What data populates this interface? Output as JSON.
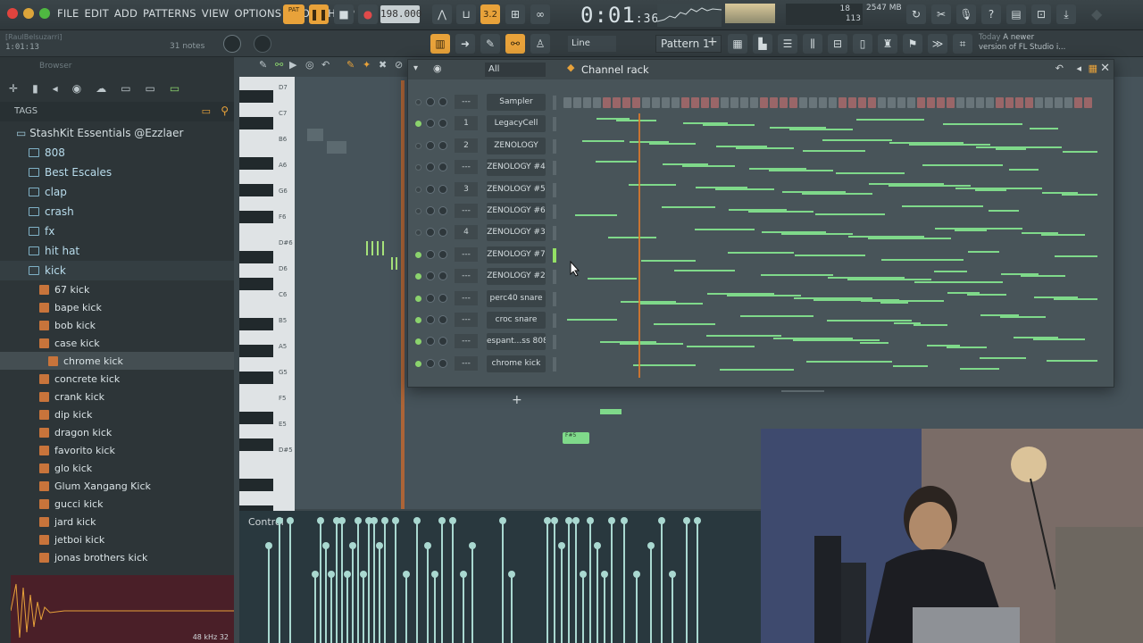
{
  "menu": [
    "FILE",
    "EDIT",
    "ADD",
    "PATTERNS",
    "VIEW",
    "OPTIONS",
    "TOOLS",
    "HELP"
  ],
  "transport": {
    "pat_label": "PAT",
    "tempo": "198.000",
    "time_main": "0:01",
    "time_sub": ":36",
    "cpu": "18",
    "mem": "2547 MB",
    "mem2": "113"
  },
  "toolbar2": {
    "user": "[RaulBelsuzarri]",
    "position": "1:01:13",
    "notes": "31 notes",
    "line_mode": "Line",
    "pattern": "Pattern 1",
    "news_date": "Today",
    "news_text1": "A newer",
    "news_text2": "version of FL Studio i..."
  },
  "browser": {
    "title": "Browser",
    "tags_label": "TAGS",
    "root": "StashKit Essentials @Ezzlaer",
    "folders": [
      "808",
      "Best Escales",
      "clap",
      "crash",
      "fx",
      "hit hat",
      "kick"
    ],
    "files": [
      "67 kick",
      "bape kick",
      "bob kick",
      "case kick",
      "chrome kick",
      "concrete kick",
      "crank kick",
      "dip kick",
      "dragon kick",
      "favorito kick",
      "glo kick",
      "Glum Xangang Kick",
      "gucci kick",
      "jard kick",
      "jetboi kick",
      "jonas brothers kick"
    ],
    "selected_file": "chrome kick",
    "wave_info": "48 kHz 32"
  },
  "pianoroll": {
    "control_label": "Control",
    "key_labels": [
      "D7",
      "C7",
      "B6",
      "A6",
      "G6",
      "F6",
      "D#6",
      "D6",
      "C6",
      "B5",
      "A5",
      "G5",
      "F5",
      "E5",
      "D#5"
    ],
    "note_label": "F#5"
  },
  "rack": {
    "title": "Channel rack",
    "filter": "All",
    "channels": [
      {
        "route": "---",
        "name": "Sampler",
        "led": false
      },
      {
        "route": "1",
        "name": "LegacyCell",
        "led": true
      },
      {
        "route": "2",
        "name": "ZENOLOGY",
        "led": false
      },
      {
        "route": "---",
        "name": "ZENOLOGY #4",
        "led": false
      },
      {
        "route": "3",
        "name": "ZENOLOGY #5",
        "led": false
      },
      {
        "route": "---",
        "name": "ZENOLOGY #6",
        "led": false
      },
      {
        "route": "4",
        "name": "ZENOLOGY #3",
        "led": false
      },
      {
        "route": "---",
        "name": "ZENOLOGY #7",
        "led": true
      },
      {
        "route": "---",
        "name": "ZENOLOGY #2",
        "led": true
      },
      {
        "route": "---",
        "name": "perc40 snare",
        "led": true
      },
      {
        "route": "---",
        "name": "croc snare",
        "led": true
      },
      {
        "route": "---",
        "name": "espant...ss 808",
        "led": true
      },
      {
        "route": "---",
        "name": "chrome kick",
        "led": true
      }
    ],
    "add_label": "+"
  },
  "colors": {
    "accent_orange": "#e8a23a",
    "led_green": "#8bd36d",
    "note_green": "#7fd98a",
    "browser_folder": "#b8dcec"
  }
}
